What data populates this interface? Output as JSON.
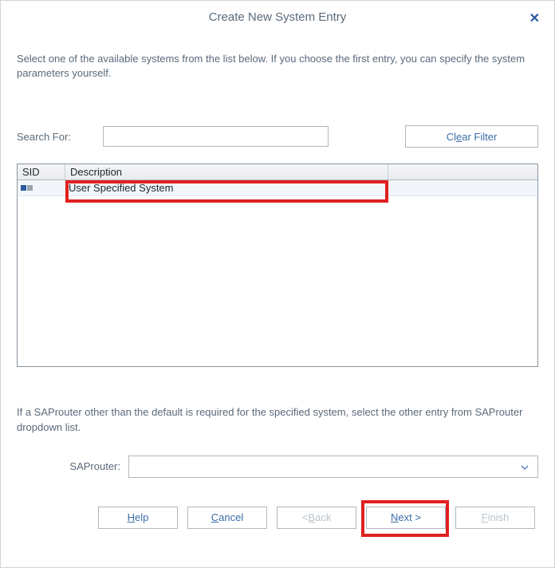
{
  "dialog": {
    "title": "Create New System Entry",
    "instruction": "Select one of the available systems from the list below. If you choose the first entry, you can specify the system parameters yourself."
  },
  "search": {
    "label": "Search For:",
    "value": ""
  },
  "clear_filter_label_pre": "Cl",
  "clear_filter_label_u": "e",
  "clear_filter_label_post": "ar Filter",
  "table": {
    "headers": {
      "sid": "SID",
      "desc": "Description"
    },
    "rows": [
      {
        "description": "User Specified System"
      }
    ]
  },
  "footer_note": "If a SAProuter other than the default is required for the specified system, select the other entry from SAProuter dropdown list.",
  "saprouter": {
    "label": "SAProuter:",
    "value": ""
  },
  "buttons": {
    "help_u": "H",
    "help_post": "elp",
    "cancel_u": "C",
    "cancel_post": "ancel",
    "back_pre": "< ",
    "back_u": "B",
    "back_post": "ack",
    "next_u": "N",
    "next_post": "ext >",
    "finish_u": "F",
    "finish_post": "inish"
  }
}
